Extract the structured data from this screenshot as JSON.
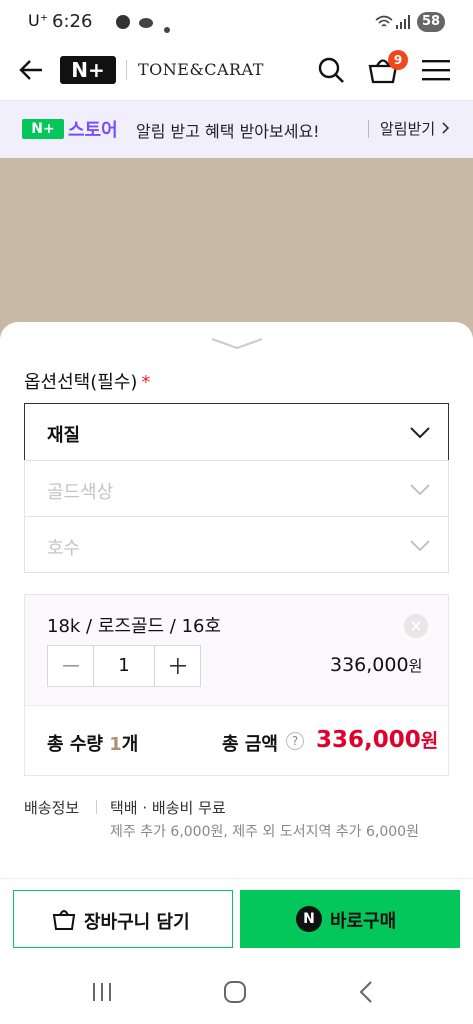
{
  "status_bar": {
    "carrier": "U⁺",
    "time": "6:26",
    "battery": "58"
  },
  "header": {
    "back_icon": "arrow-left-icon",
    "np_badge": "N+",
    "brand": "TONE&CARAT",
    "cart_count": "9"
  },
  "banner": {
    "np_mini": "N+",
    "store_word": "스토어",
    "message": "알림 받고 혜택 받아보세요!",
    "link": "알림받기"
  },
  "options": {
    "title": "옵션선택(필수)",
    "required_mark": "*",
    "selects": [
      {
        "label": "재질",
        "state": "active"
      },
      {
        "label": "골드색상",
        "state": "disabled"
      },
      {
        "label": "호수",
        "state": "disabled"
      }
    ]
  },
  "selected": {
    "name": "18k / 로즈골드 / 16호",
    "quantity": "1",
    "price": "336,000",
    "price_unit": "원"
  },
  "totals": {
    "qty_label": "총 수량",
    "qty_value": "1",
    "qty_unit": "개",
    "amount_label": "총 금액",
    "amount": "336,000",
    "amount_unit": "원",
    "help": "?"
  },
  "shipping": {
    "label": "배송정보",
    "value": "택배 · 배송비 무료",
    "note": "제주 추가 6,000원, 제주 외 도서지역 추가 6,000원"
  },
  "actions": {
    "cart_label": "장바구니 담기",
    "buy_label": "바로구매",
    "buy_badge": "N"
  },
  "colors": {
    "accent": "#03c75a",
    "price_red": "#e0002b",
    "store_purple": "#7a4dff"
  }
}
